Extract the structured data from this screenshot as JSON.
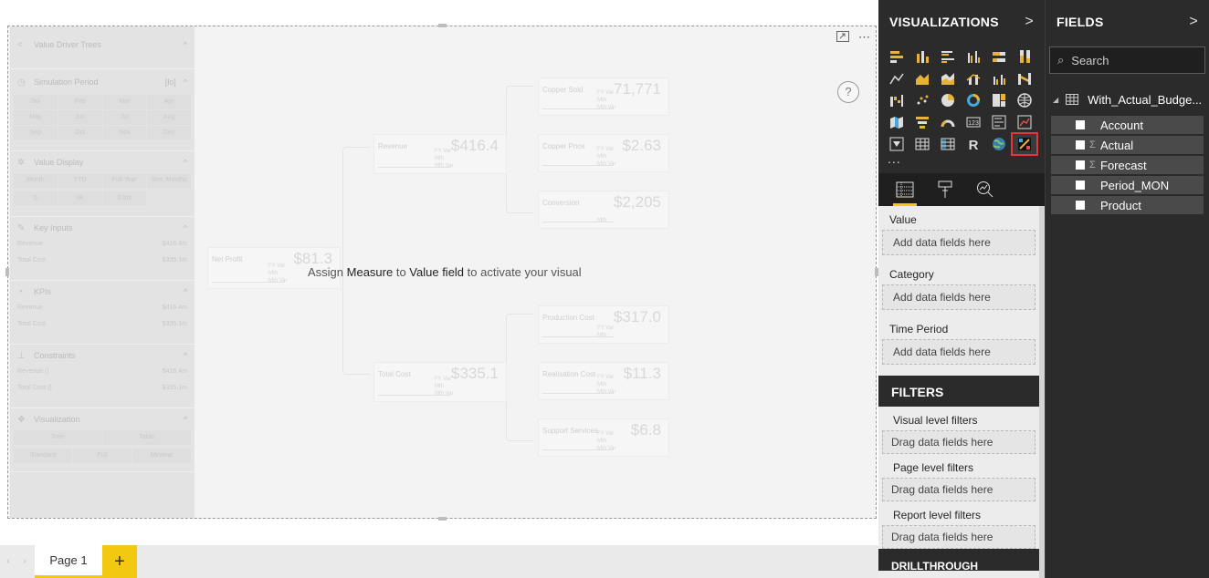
{
  "canvas": {
    "assign_message": {
      "prefix": "Assign ",
      "measure": "Measure",
      "middle": " to ",
      "value_field": "Value field",
      "suffix": " to activate your visual"
    },
    "toolbar": {
      "focus_icon": "focus-mode-icon",
      "more_options": "⋯"
    },
    "help": "?"
  },
  "settings_panel": {
    "sections": [
      {
        "title": "Value Driver Trees"
      },
      {
        "title": "Simulation Period",
        "extra": "[lo]",
        "months": [
          "Jan",
          "Feb",
          "Mar",
          "Apr",
          "May",
          "Jun",
          "Jul",
          "Aug",
          "Sep",
          "Oct",
          "Nov",
          "Dec"
        ]
      },
      {
        "title": "Value Display",
        "options": [
          "Month",
          "YTD",
          "Full Year",
          "Sim. Months"
        ],
        "values": [
          "0",
          "0k",
          "0.0m"
        ]
      },
      {
        "title": "Key Inputs",
        "rows": [
          [
            "Revenue",
            "$416.4m"
          ],
          [
            "Total Cost",
            "$335.1m"
          ]
        ]
      },
      {
        "title": "KPIs",
        "rows": [
          [
            "Revenue",
            "$416.4m"
          ],
          [
            "Total Cost",
            "$335.1m"
          ]
        ]
      },
      {
        "title": "Constraints",
        "rows": [
          [
            "Revenue ()",
            "$416.4m"
          ],
          [
            "Total Cost ()",
            "$335.1m"
          ]
        ]
      },
      {
        "title": "Visualization",
        "options": [
          "Tree",
          "Table"
        ],
        "modes": [
          "Standard",
          "Full",
          "Minimal"
        ]
      }
    ]
  },
  "tree": {
    "net_profit": {
      "label": "Net Profit",
      "value": "$81.3",
      "sub": [
        "FY Var",
        "Mth",
        "Mth Var"
      ]
    },
    "revenue": {
      "label": "Revenue",
      "value": "$416.4",
      "sub": [
        "FY Var",
        "Mth",
        "Mth Var"
      ]
    },
    "total_cost": {
      "label": "Total Cost",
      "value": "$335.1",
      "sub": [
        "FY Var",
        "Mth",
        "Mth Var"
      ]
    },
    "copper_sold": {
      "label": "Copper Sold",
      "value": "71,771",
      "sub": [
        "FY Var",
        "Mth",
        "Mth Var"
      ]
    },
    "copper_price": {
      "label": "Copper Price",
      "value": "$2.63",
      "sub": [
        "FY Var",
        "Mth",
        "Mth Var"
      ]
    },
    "conversion": {
      "label": "Conversion",
      "value": "$2,205",
      "sub": [
        "Mth"
      ]
    },
    "production_cost": {
      "label": "Production Cost",
      "value": "$317.0",
      "sub": [
        "FY Var",
        "Mth"
      ]
    },
    "realisation_cost": {
      "label": "Realisation Cost",
      "value": "$11.3",
      "sub": [
        "FY Var",
        "Mth",
        "Mth Var"
      ]
    },
    "support_services": {
      "label": "Support Services",
      "value": "$6.8",
      "sub": [
        "FY Var",
        "Mth",
        "Mth Var"
      ]
    }
  },
  "page_tabs": {
    "tabs": [
      "Page 1"
    ],
    "add_label": "+"
  },
  "visualizations": {
    "title": "VISUALIZATIONS",
    "expand_arrow": ">",
    "more": "...",
    "icons": [
      "stacked-bar-chart-icon",
      "stacked-column-chart-icon",
      "clustered-bar-chart-icon",
      "clustered-column-chart-icon",
      "100-percent-bar-chart-icon",
      "100-percent-column-chart-icon",
      "line-chart-icon",
      "area-chart-icon",
      "stacked-area-chart-icon",
      "line-and-column-chart-icon",
      "line-and-clustered-column-chart-icon",
      "ribbon-chart-icon",
      "waterfall-chart-icon",
      "scatter-chart-icon",
      "pie-chart-icon",
      "donut-chart-icon",
      "treemap-icon",
      "map-icon",
      "filled-map-icon",
      "funnel-icon",
      "gauge-icon",
      "card-icon",
      "multi-row-card-icon",
      "kpi-icon",
      "slicer-icon",
      "table-icon",
      "matrix-icon",
      "r-script-visual-icon",
      "globe-map-icon",
      "value-driver-tree-visual-icon"
    ],
    "tabs": [
      "fields-tab-icon",
      "format-tab-icon",
      "analytics-tab-icon"
    ],
    "wells": [
      {
        "label": "Value",
        "placeholder": "Add data fields here"
      },
      {
        "label": "Category",
        "placeholder": "Add data fields here"
      },
      {
        "label": "Time Period",
        "placeholder": "Add data fields here"
      }
    ],
    "filters": {
      "title": "FILTERS",
      "levels": [
        {
          "label": "Visual level filters",
          "placeholder": "Drag data fields here"
        },
        {
          "label": "Page level filters",
          "placeholder": "Drag data fields here"
        },
        {
          "label": "Report level filters",
          "placeholder": "Drag data fields here"
        }
      ]
    },
    "drillthrough_title": "DRILLTHROUGH"
  },
  "fields": {
    "title": "FIELDS",
    "expand_arrow": ">",
    "search_placeholder": "Search",
    "table_name": "With_Actual_Budge...",
    "items": [
      {
        "name": "Account",
        "sigma": ""
      },
      {
        "name": "Actual",
        "sigma": "Σ"
      },
      {
        "name": "Forecast",
        "sigma": "Σ"
      },
      {
        "name": "Period_MON",
        "sigma": ""
      },
      {
        "name": "Product",
        "sigma": ""
      }
    ]
  },
  "colors": {
    "accent_yellow": "#f2c811",
    "pane_dark": "#2b2b2b",
    "selection_red": "#e03838"
  }
}
